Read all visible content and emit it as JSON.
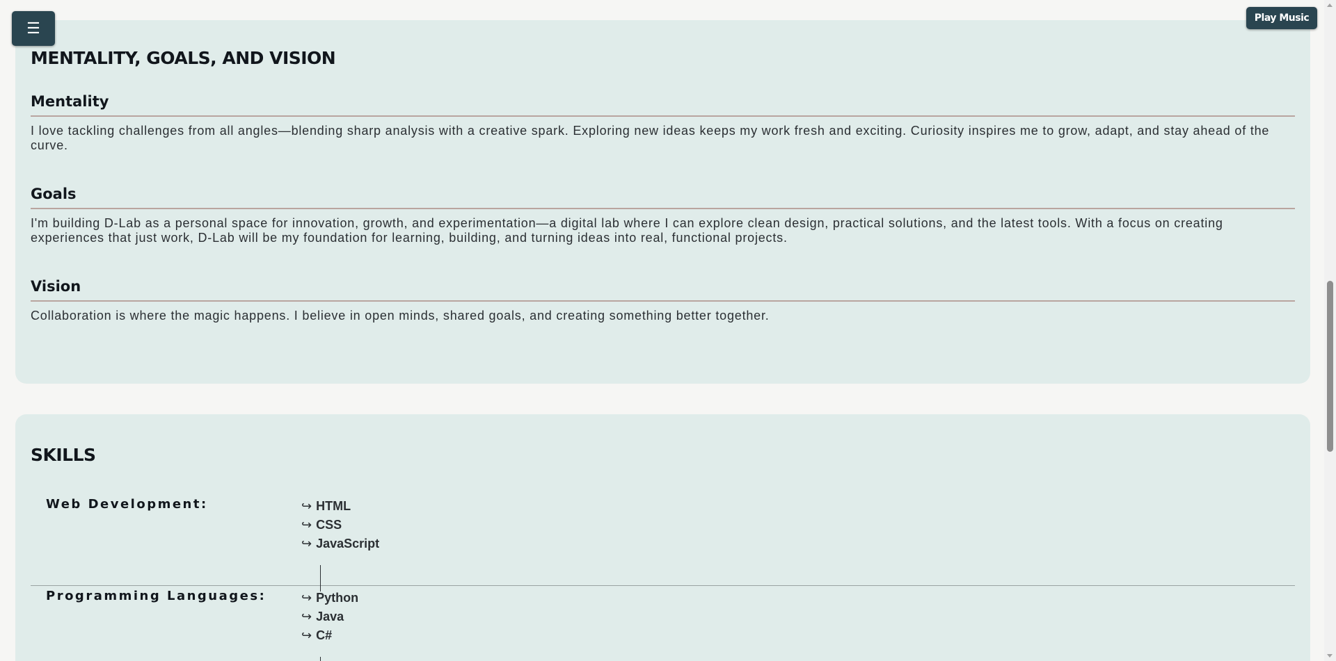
{
  "header": {
    "menu_icon": "☰",
    "play_music_label": "Play Music"
  },
  "mentality_section": {
    "title": "MENTALITY, GOALS, AND VISION",
    "subsections": [
      {
        "heading": "Mentality",
        "text": "I love tackling challenges from all angles—blending sharp analysis with a creative spark. Exploring new ideas keeps my work fresh and exciting. Curiosity inspires me to grow, adapt, and stay ahead of the curve."
      },
      {
        "heading": "Goals",
        "text": "I'm building D-Lab as a personal space for innovation, growth, and experimentation—a digital lab where I can explore clean design, practical solutions, and the latest tools. With a focus on creating experiences that just work, D-Lab will be my foundation for learning, building, and turning ideas into real, functional projects."
      },
      {
        "heading": "Vision",
        "text": "Collaboration is where the magic happens. I believe in open minds, shared goals, and creating something better together."
      }
    ]
  },
  "skills_section": {
    "title": "SKILLS",
    "arrow_glyph": "↪",
    "categories": [
      {
        "label": "Web Development:",
        "items": [
          "HTML",
          "CSS",
          "JavaScript"
        ]
      },
      {
        "label": "Programming Languages:",
        "items": [
          "Python",
          "Java",
          "C#"
        ]
      }
    ]
  }
}
